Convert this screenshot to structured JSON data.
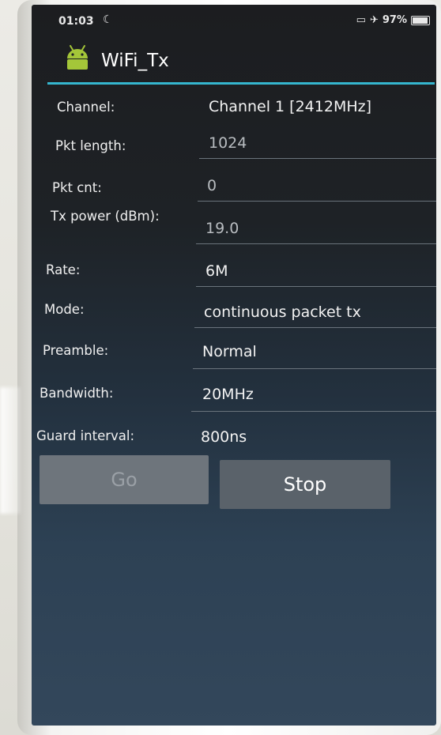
{
  "status_bar": {
    "time": "01:03",
    "dnd_icon": "moon-icon",
    "sim_icon": "sim-card-icon",
    "airplane_icon": "airplane-icon",
    "battery_percent": "97%"
  },
  "app": {
    "title": "WiFi_Tx",
    "icon": "android-icon",
    "accent_color": "#35b6cf"
  },
  "form": {
    "channel_label": "Channel:",
    "channel_value": "Channel 1 [2412MHz]",
    "pkt_length_label": "Pkt length:",
    "pkt_length_value": "1024",
    "pkt_cnt_label": "Pkt cnt:",
    "pkt_cnt_value": "0",
    "tx_power_label": "Tx power (dBm):",
    "tx_power_value": "19.0",
    "rate_label": "Rate:",
    "rate_value": "6M",
    "mode_label": "Mode:",
    "mode_value": "continuous packet tx",
    "preamble_label": "Preamble:",
    "preamble_value": "Normal",
    "bandwidth_label": "Bandwidth:",
    "bandwidth_value": "20MHz",
    "guard_interval_label": "Guard interval:",
    "guard_interval_value": "800ns"
  },
  "buttons": {
    "go_label": "Go",
    "stop_label": "Stop"
  }
}
